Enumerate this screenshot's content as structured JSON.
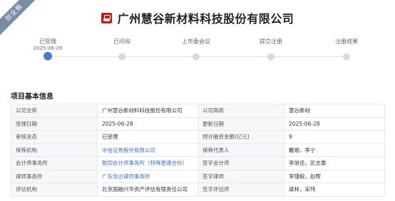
{
  "ribbon": {
    "label": "创业板"
  },
  "header": {
    "company_name": "广州慧谷新材料科技股份有限公司"
  },
  "timeline": {
    "steps": [
      {
        "label": "已受理",
        "date": "2025-06-28",
        "active": true
      },
      {
        "label": "已问询",
        "date": "",
        "active": false
      },
      {
        "label": "上市委会议",
        "date": "",
        "active": false
      },
      {
        "label": "提交注册",
        "date": "",
        "active": false
      },
      {
        "label": "注册结果",
        "date": "",
        "active": false
      }
    ]
  },
  "section": {
    "title": "项目基本信息"
  },
  "table": {
    "rows": [
      {
        "l1": "公司全称",
        "v1": "广州慧谷新材料科技股份有限公司",
        "l2": "公司简称",
        "v2": "慧谷新材"
      },
      {
        "l1": "受理日期",
        "v1": "2025-06-28",
        "l2": "更新日期",
        "v2": "2025-06-28"
      },
      {
        "l1": "审核状态",
        "v1": "已受理",
        "l2": "预计融资金额(亿元)",
        "v2": "9"
      },
      {
        "l1": "保荐机构",
        "v1": "中信证券股份有限公司",
        "l2": "保荐代表人",
        "v2": "戴顺，李宁"
      },
      {
        "l1": "会计师事务所",
        "v1": "致同会计师事务所（特殊普通合伙）",
        "l2": "签字会计师",
        "v2": "李旭佳，区志豪"
      },
      {
        "l1": "律师事务所",
        "v1": "广东信达律师事务所",
        "l2": "签字律师",
        "v2": "李瑾蛟，赵晖"
      },
      {
        "l1": "评估机构",
        "v1": "北京国融兴华资产评估有限责任公司",
        "l2": "签字评估师",
        "v2": "梁林，宋玮"
      }
    ]
  },
  "colors": {
    "accent": "#4a7bd0",
    "link": "#3d6fc4",
    "brand_red": "#c8161d",
    "ribbon": "#7a8ba6"
  }
}
